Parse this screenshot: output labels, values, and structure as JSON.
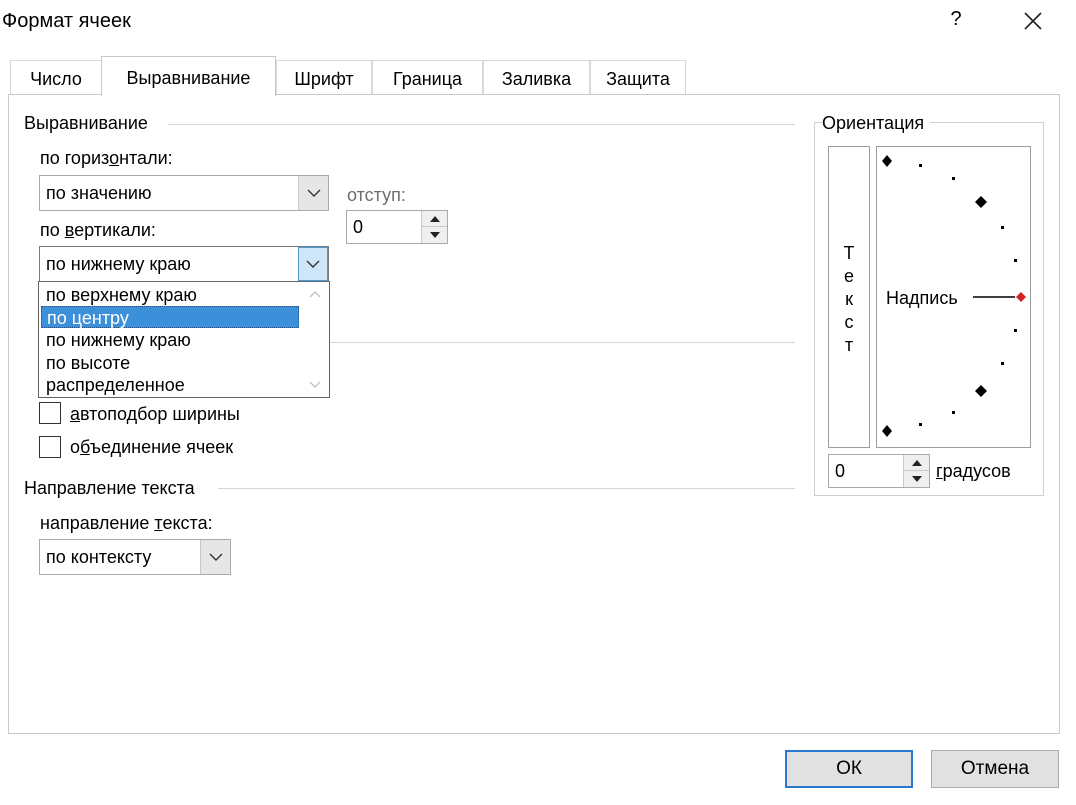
{
  "window": {
    "title": "Формат ячеек",
    "help_glyph": "?"
  },
  "tabs": [
    {
      "label": "Число",
      "active": false
    },
    {
      "label": "Выравнивание",
      "active": true
    },
    {
      "label": "Шрифт",
      "active": false
    },
    {
      "label": "Граница",
      "active": false
    },
    {
      "label": "Заливка",
      "active": false
    },
    {
      "label": "Защита",
      "active": false
    }
  ],
  "alignment": {
    "group_title": "Выравнивание",
    "horizontal_label_pre": "по гориз",
    "horizontal_label_key": "о",
    "horizontal_label_post": "нтали:",
    "horizontal_value": "по значению",
    "indent_label": "отступ:",
    "indent_value": "0",
    "vertical_label_pre": "по ",
    "vertical_label_key": "в",
    "vertical_label_post": "ертикали:",
    "vertical_value": "по нижнему краю",
    "vertical_options": [
      {
        "label": "по верхнему краю",
        "selected": false
      },
      {
        "label": "по центру",
        "selected": true
      },
      {
        "label": "по нижнему краю",
        "selected": false
      },
      {
        "label": "по высоте",
        "selected": false
      },
      {
        "label": "распределенное",
        "selected": false
      }
    ]
  },
  "display": {
    "autofit_key": "а",
    "autofit_rest": "втоподбор ширины",
    "autofit_checked": false,
    "merge_pre": "о",
    "merge_key": "б",
    "merge_post": "ъединение ячеек",
    "merge_checked": false
  },
  "text_direction": {
    "group_title": "Направление текста",
    "label_pre": "направление ",
    "label_key": "т",
    "label_post": "екста:",
    "value": "по контексту"
  },
  "orientation": {
    "group_title": "Ориентация",
    "vertical_letters": [
      "Т",
      "е",
      "к",
      "с",
      "т"
    ],
    "dial_label": "Надпись",
    "degrees_value": "0",
    "degrees_key": "г",
    "degrees_rest": "радусов"
  },
  "buttons": {
    "ok": "ОК",
    "cancel": "Отмена"
  },
  "colors": {
    "accent": "#3c8fd9",
    "dial_marker": "#d42020"
  }
}
